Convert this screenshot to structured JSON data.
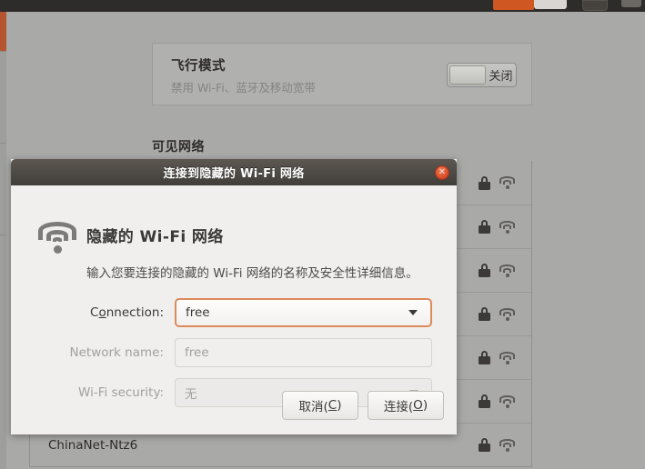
{
  "topbar": {
    "indicator_orange": "orange-indicator",
    "indicator_white": "white-indicator"
  },
  "settings_window": {
    "airplane_mode": {
      "title": "飞行模式",
      "subtitle": "禁用 Wi-Fi、蓝牙及移动宽带",
      "toggle_state_label": "关闭"
    },
    "visible_networks_heading": "可见网络",
    "networks": [
      {
        "name": "",
        "secured": true,
        "signal": "wifi-icon"
      },
      {
        "name": "",
        "secured": true,
        "signal": "wifi-icon"
      },
      {
        "name": "",
        "secured": true,
        "signal": "wifi-icon"
      },
      {
        "name": "",
        "secured": true,
        "signal": "wifi-icon"
      },
      {
        "name": "",
        "secured": true,
        "signal": "wifi-icon"
      },
      {
        "name": "",
        "secured": true,
        "signal": "wifi-icon"
      },
      {
        "name": "ChinaNet-Ntz6",
        "secured": true,
        "signal": "wifi-icon"
      }
    ]
  },
  "dialog": {
    "titlebar": {
      "title": "连接到隐藏的 Wi-Fi 网络",
      "close_glyph": "✕"
    },
    "heading": "隐藏的 Wi-Fi 网络",
    "description": "输入您要连接的隐藏的 Wi-Fi 网络的名称及安全性详细信息。",
    "fields": {
      "connection": {
        "label_pre": "C",
        "label_mnemonic": "o",
        "label_post": "nnection:",
        "value": "free"
      },
      "network_name": {
        "label": "Network name:",
        "value": "free"
      },
      "wifi_security": {
        "label": "Wi-Fi security:",
        "value": "无"
      }
    },
    "buttons": {
      "cancel": {
        "text": "取消(",
        "mnemonic": "C",
        "text_end": ")"
      },
      "connect": {
        "text": "连接(",
        "mnemonic": "O",
        "text_end": ")"
      }
    }
  },
  "colors": {
    "desktop_bg": "#a9a9a7",
    "dialog_bg": "#f0efed",
    "titlebar_dark": "#413e3a",
    "focus_orange": "#dd8a5c",
    "close_red": "#d4472a",
    "launcher_accent": "#b5552f"
  }
}
